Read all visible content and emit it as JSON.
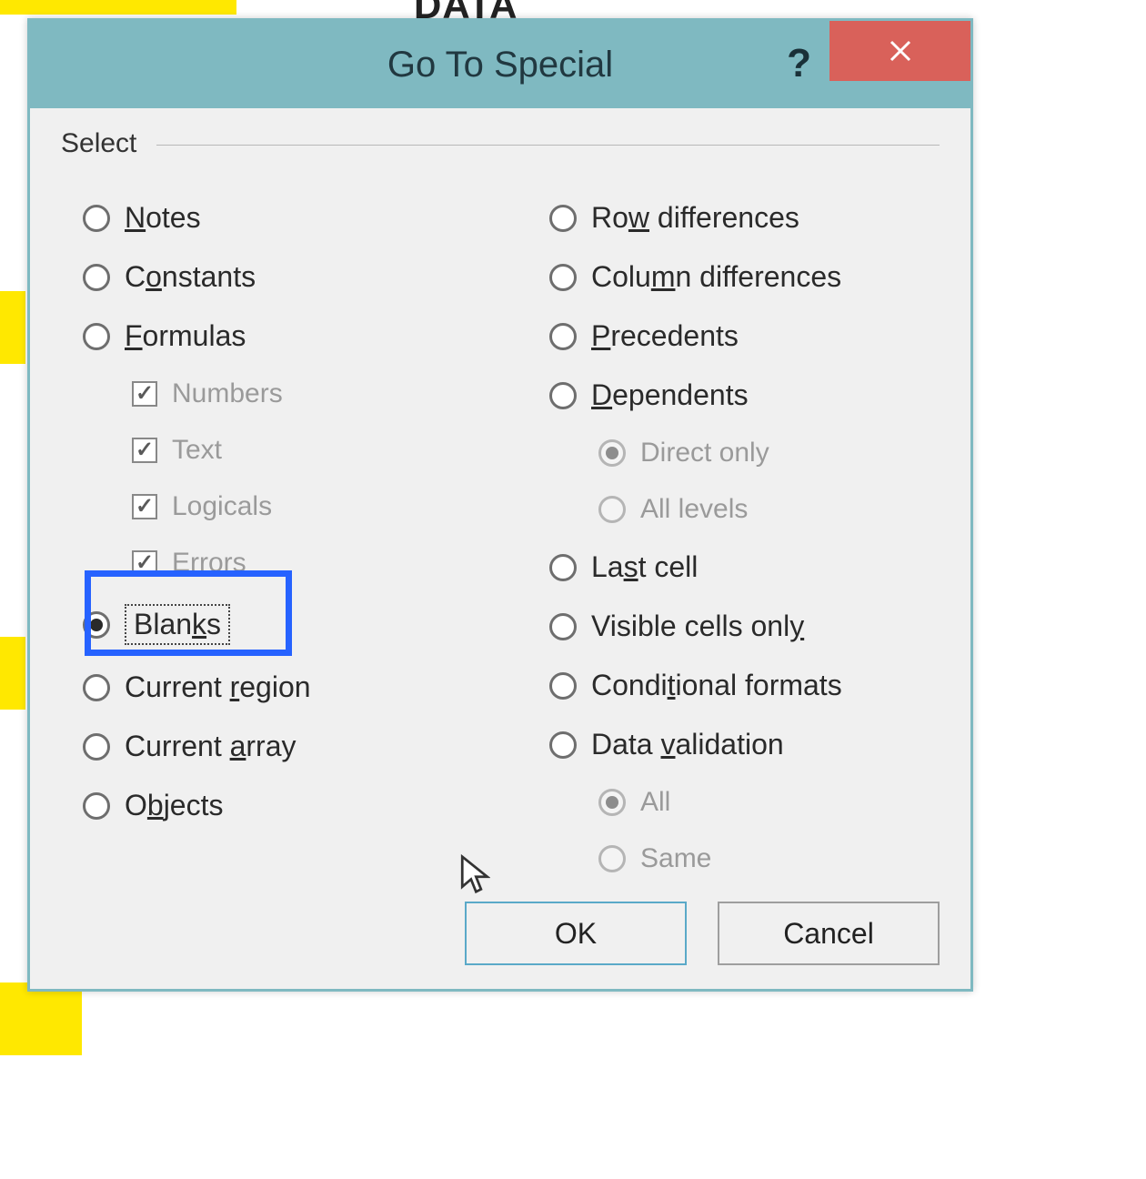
{
  "background": {
    "header_text": "DATA"
  },
  "dialog": {
    "title": "Go To Special",
    "section_label": "Select",
    "left": {
      "notes": "Notes",
      "constants": "Constants",
      "formulas": "Formulas",
      "numbers": "Numbers",
      "text": "Text",
      "logicals": "Logicals",
      "errors": "Errors",
      "blanks": "Blanks",
      "current_region": "Current region",
      "current_array": "Current array",
      "objects": "Objects"
    },
    "right": {
      "row_diff": "Row differences",
      "col_diff": "Column differences",
      "precedents": "Precedents",
      "dependents": "Dependents",
      "direct_only": "Direct only",
      "all_levels": "All levels",
      "last_cell": "Last cell",
      "visible_cells": "Visible cells only",
      "cond_formats": "Conditional formats",
      "data_validation": "Data validation",
      "dv_all": "All",
      "dv_same": "Same"
    },
    "buttons": {
      "ok": "OK",
      "cancel": "Cancel"
    }
  }
}
